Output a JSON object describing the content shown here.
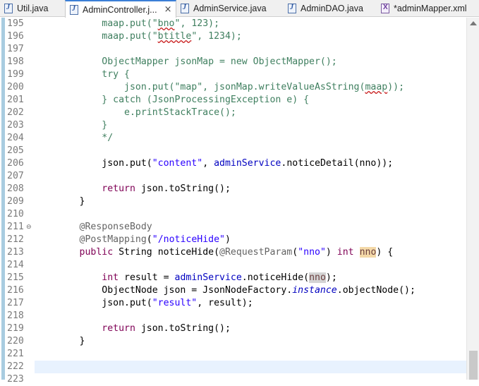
{
  "tabs": [
    {
      "label": "Util.java",
      "icon": "java-file-icon",
      "active": false
    },
    {
      "label": "AdminController.j...",
      "icon": "java-file-icon",
      "active": true,
      "close": "×"
    },
    {
      "label": "AdminService.java",
      "icon": "java-file-icon",
      "active": false
    },
    {
      "label": "AdminDAO.java",
      "icon": "java-file-icon",
      "active": false
    },
    {
      "label": "*adminMapper.xml",
      "icon": "xml-file-icon",
      "active": false
    }
  ],
  "fold_marker": "⊖",
  "current_line": "222",
  "lines": [
    {
      "n": "195",
      "t": [
        [
          "c",
          "            maap.put(\""
        ],
        [
          "c",
          "bno",
          "sq"
        ],
        [
          "c",
          "\", 123);"
        ]
      ]
    },
    {
      "n": "196",
      "t": [
        [
          "c",
          "            maap.put(\""
        ],
        [
          "c",
          "btitle",
          "sq"
        ],
        [
          "c",
          "\", 1234);"
        ]
      ]
    },
    {
      "n": "197",
      "t": []
    },
    {
      "n": "198",
      "t": [
        [
          "c",
          "            ObjectMapper jsonMap = new ObjectMapper();"
        ]
      ]
    },
    {
      "n": "199",
      "t": [
        [
          "c",
          "            try {"
        ]
      ]
    },
    {
      "n": "200",
      "t": [
        [
          "c",
          "                json.put(\"map\", jsonMap.writeValueAsString("
        ],
        [
          "c",
          "maap",
          "sq"
        ],
        [
          "c",
          "));"
        ]
      ]
    },
    {
      "n": "201",
      "t": [
        [
          "c",
          "            } catch (JsonProcessingException e) {"
        ]
      ]
    },
    {
      "n": "202",
      "t": [
        [
          "c",
          "                e.printStackTrace();"
        ]
      ]
    },
    {
      "n": "203",
      "t": [
        [
          "c",
          "            }"
        ]
      ]
    },
    {
      "n": "204",
      "t": [
        [
          "c",
          "            */"
        ]
      ]
    },
    {
      "n": "205",
      "t": []
    },
    {
      "n": "206",
      "t": [
        [
          "p",
          "            json.put("
        ],
        [
          "s",
          "\"content\""
        ],
        [
          "p",
          ", "
        ],
        [
          "f",
          "adminService"
        ],
        [
          "p",
          ".noticeDetail(nno));"
        ]
      ]
    },
    {
      "n": "207",
      "t": []
    },
    {
      "n": "208",
      "t": [
        [
          "p",
          "            "
        ],
        [
          "k",
          "return"
        ],
        [
          "p",
          " json.toString();"
        ]
      ]
    },
    {
      "n": "209",
      "t": [
        [
          "p",
          "        }"
        ]
      ]
    },
    {
      "n": "210",
      "t": []
    },
    {
      "n": "211",
      "fold": true,
      "t": [
        [
          "a",
          "        @ResponseBody"
        ]
      ]
    },
    {
      "n": "212",
      "t": [
        [
          "a",
          "        @PostMapping"
        ],
        [
          "p",
          "("
        ],
        [
          "s",
          "\"/noticeHide\""
        ],
        [
          "p",
          ")"
        ]
      ]
    },
    {
      "n": "213",
      "t": [
        [
          "p",
          "        "
        ],
        [
          "k",
          "public"
        ],
        [
          "p",
          " String noticeHide("
        ],
        [
          "a",
          "@RequestParam"
        ],
        [
          "p",
          "("
        ],
        [
          "s",
          "\"nno\""
        ],
        [
          "p",
          ") "
        ],
        [
          "k",
          "int"
        ],
        [
          "p",
          " "
        ],
        [
          "v",
          "nno",
          "sel"
        ],
        [
          "p",
          ") {"
        ]
      ]
    },
    {
      "n": "214",
      "t": []
    },
    {
      "n": "215",
      "t": [
        [
          "p",
          "            "
        ],
        [
          "k",
          "int"
        ],
        [
          "p",
          " result = "
        ],
        [
          "f",
          "adminService"
        ],
        [
          "p",
          ".noticeHide("
        ],
        [
          "v",
          "nno",
          "occ"
        ],
        [
          "p",
          ");"
        ]
      ]
    },
    {
      "n": "216",
      "t": [
        [
          "p",
          "            ObjectNode json = JsonNodeFactory."
        ],
        [
          "i",
          "instance"
        ],
        [
          "p",
          ".objectNode();"
        ]
      ]
    },
    {
      "n": "217",
      "t": [
        [
          "p",
          "            json.put("
        ],
        [
          "s",
          "\"result\""
        ],
        [
          "p",
          ", result);"
        ]
      ]
    },
    {
      "n": "218",
      "t": []
    },
    {
      "n": "219",
      "t": [
        [
          "p",
          "            "
        ],
        [
          "k",
          "return"
        ],
        [
          "p",
          " json.toString();"
        ]
      ]
    },
    {
      "n": "220",
      "t": [
        [
          "p",
          "        }"
        ]
      ]
    },
    {
      "n": "221",
      "t": []
    },
    {
      "n": "222",
      "t": []
    },
    {
      "n": "223",
      "t": []
    }
  ],
  "colors": {
    "comment": "#3f7f5f",
    "keyword": "#7f0055",
    "string": "#2a00ff",
    "annotation": "#646464",
    "field": "#0000c0",
    "current_line": "#e8f2fe",
    "active_tab_border": "#3b7fd6"
  }
}
